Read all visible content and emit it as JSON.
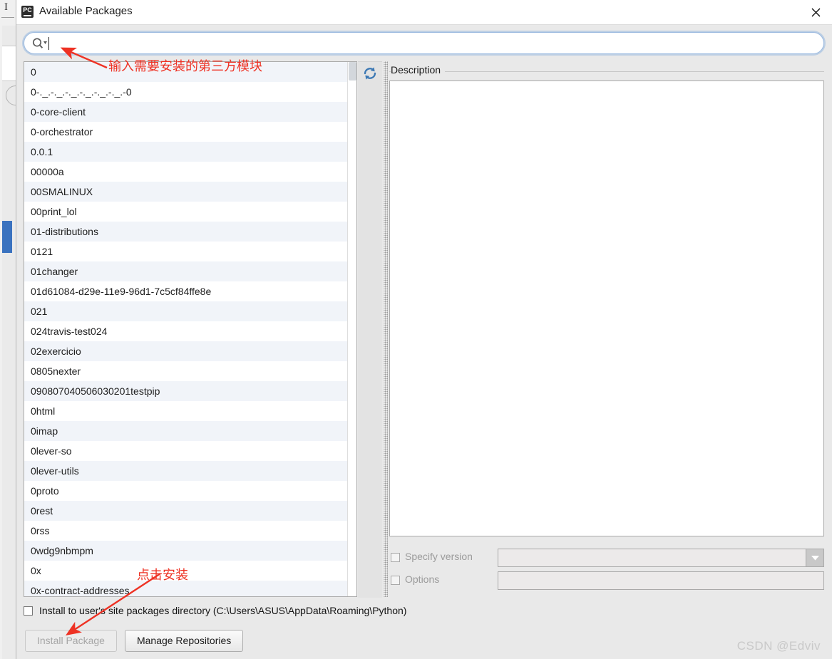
{
  "background_window": {
    "letter": "I"
  },
  "dialog": {
    "title": "Available Packages",
    "app_icon": "pycharm-icon",
    "close_icon": "close-icon"
  },
  "search": {
    "icon": "search-icon",
    "dropdown_icon": "chevron-down-icon",
    "value": "",
    "placeholder": ""
  },
  "package_list": {
    "items": [
      "0",
      "0-._.-._.-._.-._.-._.-._.-0",
      "0-core-client",
      "0-orchestrator",
      "0.0.1",
      "00000a",
      "00SMALINUX",
      "00print_lol",
      "01-distributions",
      "0121",
      "01changer",
      "01d61084-d29e-11e9-96d1-7c5cf84ffe8e",
      "021",
      "024travis-test024",
      "02exercicio",
      "0805nexter",
      "090807040506030201testpip",
      "0html",
      "0imap",
      "0lever-so",
      "0lever-utils",
      "0proto",
      "0rest",
      "0rss",
      "0wdg9nbmpm",
      "0x",
      "0x-contract-addresses"
    ]
  },
  "refresh": {
    "icon": "refresh-icon"
  },
  "description": {
    "label": "Description",
    "body": ""
  },
  "options": {
    "specify_version": {
      "label": "Specify version",
      "checked": false,
      "enabled": false,
      "value": "",
      "dropdown_icon": "chevron-down-icon"
    },
    "options_field": {
      "label": "Options",
      "checked": false,
      "enabled": false,
      "value": ""
    }
  },
  "footer": {
    "install_to_user_label": "Install to user's site packages directory (C:\\Users\\ASUS\\AppData\\Roaming\\Python)",
    "install_to_user_checked": false,
    "install_button": "Install Package",
    "install_button_enabled": false,
    "manage_button": "Manage Repositories"
  },
  "annotations": [
    {
      "text": "输入需要安装的第三方模块",
      "name": "annotation-search-hint"
    },
    {
      "text": "点击安装",
      "name": "annotation-install-hint"
    }
  ],
  "watermark": "CSDN @Edviv",
  "colors": {
    "accent": "#3a72bf",
    "annotation": "#ee3224",
    "row_alt": "#f1f4f9",
    "dialog_bg": "#e9e9e9"
  }
}
